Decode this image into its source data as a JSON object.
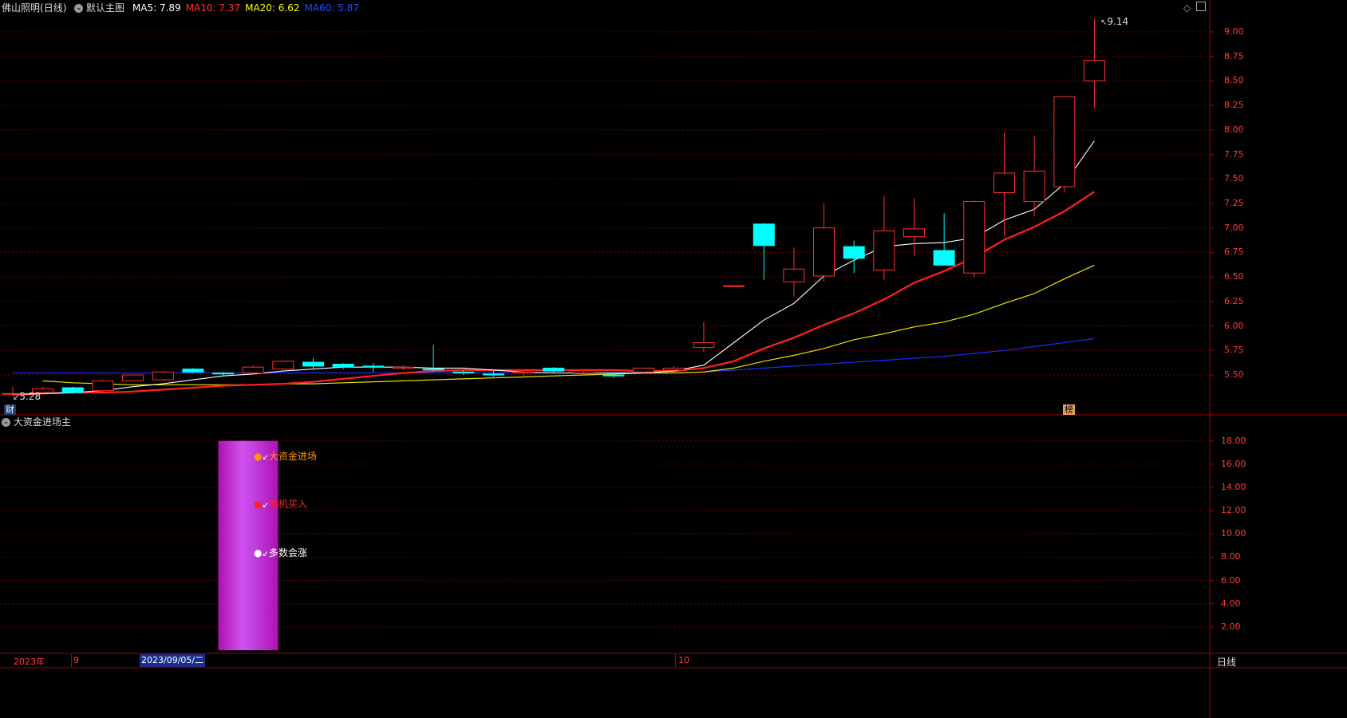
{
  "main_panel": {
    "stock_name": "佛山照明",
    "period_tag": "(日线)",
    "template_label": "默认主图",
    "ma": [
      {
        "label": "MA5:",
        "value": "7.89",
        "color": "#ffffff"
      },
      {
        "label": "MA10:",
        "value": "7.37",
        "color": "#ff3030"
      },
      {
        "label": "MA20:",
        "value": "6.62",
        "color": "#ffff00"
      },
      {
        "label": "MA60:",
        "value": "5.87",
        "color": "#2050ff"
      }
    ],
    "y_ticks": [
      "9.00",
      "8.75",
      "8.50",
      "8.25",
      "8.00",
      "7.75",
      "7.50",
      "7.25",
      "7.00",
      "6.75",
      "6.50",
      "6.25",
      "6.00",
      "5.75",
      "5.50"
    ],
    "high_label": "9.14",
    "low_label": "5.28",
    "badge_left": "财",
    "badge_right": "榜"
  },
  "indicator_panel": {
    "title": "大资金进场主",
    "y_ticks": [
      "18.00",
      "16.00",
      "14.00",
      "12.00",
      "10.00",
      "8.00",
      "6.00",
      "4.00",
      "2.00"
    ],
    "labels": [
      {
        "text": "大资金进场",
        "color": "#ff9900"
      },
      {
        "text": "游机买入",
        "color": "#ff2020"
      },
      {
        "text": "多数会涨",
        "color": "#ffffff"
      }
    ]
  },
  "time_axis": {
    "year": "2023年",
    "month_sep": "9",
    "selected_date": "2023/09/05/二",
    "month_oct": "10",
    "period_button": "日线"
  },
  "colors": {
    "up": "#ff3030",
    "down": "#00ffff",
    "grid": "#6a0000",
    "axis_text": "#ff3b3b",
    "magenta_band": "#c23cdc"
  },
  "chart_data": {
    "type": "candlestick",
    "ylim": [
      5.2,
      9.25
    ],
    "candles": [
      {
        "o": 5.31,
        "h": 5.38,
        "l": 5.28,
        "c": 5.31
      },
      {
        "o": 5.32,
        "h": 5.38,
        "l": 5.3,
        "c": 5.36
      },
      {
        "o": 5.37,
        "h": 5.38,
        "l": 5.31,
        "c": 5.32
      },
      {
        "o": 5.34,
        "h": 5.45,
        "l": 5.33,
        "c": 5.44
      },
      {
        "o": 5.44,
        "h": 5.5,
        "l": 5.43,
        "c": 5.5
      },
      {
        "o": 5.45,
        "h": 5.54,
        "l": 5.44,
        "c": 5.53
      },
      {
        "o": 5.56,
        "h": 5.57,
        "l": 5.52,
        "c": 5.53
      },
      {
        "o": 5.52,
        "h": 5.53,
        "l": 5.49,
        "c": 5.51
      },
      {
        "o": 5.52,
        "h": 5.6,
        "l": 5.51,
        "c": 5.58
      },
      {
        "o": 5.56,
        "h": 5.65,
        "l": 5.55,
        "c": 5.64
      },
      {
        "o": 5.63,
        "h": 5.67,
        "l": 5.57,
        "c": 5.59
      },
      {
        "o": 5.61,
        "h": 5.62,
        "l": 5.56,
        "c": 5.58
      },
      {
        "o": 5.59,
        "h": 5.62,
        "l": 5.53,
        "c": 5.58
      },
      {
        "o": 5.57,
        "h": 5.6,
        "l": 5.55,
        "c": 5.58
      },
      {
        "o": 5.56,
        "h": 5.81,
        "l": 5.53,
        "c": 5.55
      },
      {
        "o": 5.53,
        "h": 5.55,
        "l": 5.5,
        "c": 5.52
      },
      {
        "o": 5.51,
        "h": 5.54,
        "l": 5.48,
        "c": 5.5
      },
      {
        "o": 5.52,
        "h": 5.54,
        "l": 5.47,
        "c": 5.53
      },
      {
        "o": 5.57,
        "h": 5.58,
        "l": 5.52,
        "c": 5.54
      },
      {
        "o": 5.52,
        "h": 5.54,
        "l": 5.5,
        "c": 5.52
      },
      {
        "o": 5.5,
        "h": 5.52,
        "l": 5.47,
        "c": 5.49
      },
      {
        "o": 5.53,
        "h": 5.57,
        "l": 5.51,
        "c": 5.57
      },
      {
        "o": 5.55,
        "h": 5.59,
        "l": 5.52,
        "c": 5.57
      },
      {
        "o": 5.78,
        "h": 6.04,
        "l": 5.73,
        "c": 5.83
      },
      {
        "o": 6.41,
        "h": 6.41,
        "l": 6.41,
        "c": 6.41
      },
      {
        "o": 7.04,
        "h": 7.05,
        "l": 6.47,
        "c": 6.82
      },
      {
        "o": 6.45,
        "h": 6.8,
        "l": 6.3,
        "c": 6.58
      },
      {
        "o": 6.51,
        "h": 7.25,
        "l": 6.45,
        "c": 7.0
      },
      {
        "o": 6.81,
        "h": 6.87,
        "l": 6.54,
        "c": 6.69
      },
      {
        "o": 6.57,
        "h": 7.33,
        "l": 6.47,
        "c": 6.97
      },
      {
        "o": 6.91,
        "h": 7.3,
        "l": 6.71,
        "c": 6.99
      },
      {
        "o": 6.77,
        "h": 7.15,
        "l": 6.62,
        "c": 6.62
      },
      {
        "o": 6.54,
        "h": 7.28,
        "l": 6.5,
        "c": 7.27
      },
      {
        "o": 7.36,
        "h": 7.97,
        "l": 6.92,
        "c": 7.56
      },
      {
        "o": 7.27,
        "h": 7.94,
        "l": 7.12,
        "c": 7.58
      },
      {
        "o": 7.42,
        "h": 8.34,
        "l": 7.36,
        "c": 8.34
      },
      {
        "o": 8.5,
        "h": 9.14,
        "l": 8.22,
        "c": 8.71
      }
    ],
    "ma5": [
      5.3,
      5.31,
      5.32,
      5.34,
      5.38,
      5.41,
      5.45,
      5.49,
      5.51,
      5.54,
      5.56,
      5.58,
      5.58,
      5.58,
      5.57,
      5.57,
      5.55,
      5.53,
      5.52,
      5.52,
      5.52,
      5.52,
      5.54,
      5.6,
      5.83,
      6.06,
      6.23,
      6.51,
      6.67,
      6.81,
      6.84,
      6.85,
      6.9,
      7.08,
      7.19,
      7.45,
      7.89
    ],
    "ma10": [
      5.3,
      5.31,
      5.32,
      5.32,
      5.33,
      5.35,
      5.37,
      5.39,
      5.4,
      5.41,
      5.43,
      5.46,
      5.49,
      5.52,
      5.54,
      5.55,
      5.55,
      5.55,
      5.55,
      5.55,
      5.55,
      5.54,
      5.54,
      5.57,
      5.64,
      5.77,
      5.88,
      6.01,
      6.13,
      6.27,
      6.44,
      6.56,
      6.7,
      6.88,
      7.01,
      7.17,
      7.37
    ],
    "ma20": [
      5.44,
      5.42,
      5.41,
      5.4,
      5.4,
      5.4,
      5.4,
      5.4,
      5.41,
      5.41,
      5.42,
      5.43,
      5.44,
      5.45,
      5.46,
      5.47,
      5.48,
      5.49,
      5.5,
      5.51,
      5.52,
      5.52,
      5.53,
      5.57,
      5.64,
      5.7,
      5.77,
      5.86,
      5.92,
      5.99,
      6.04,
      6.12,
      6.23,
      6.33,
      6.48,
      6.62
    ],
    "ma60": [
      5.52,
      5.52,
      5.52,
      5.52,
      5.52,
      5.52,
      5.52,
      5.52,
      5.52,
      5.52,
      5.52,
      5.52,
      5.52,
      5.52,
      5.52,
      5.52,
      5.52,
      5.52,
      5.52,
      5.52,
      5.52,
      5.52,
      5.52,
      5.53,
      5.55,
      5.57,
      5.59,
      5.61,
      5.63,
      5.65,
      5.67,
      5.69,
      5.72,
      5.75,
      5.79,
      5.83,
      5.87
    ],
    "indicator": {
      "type": "bar",
      "ylim": [
        0,
        19.2
      ],
      "band_value": 18.0,
      "markers": [
        16.0,
        12.0,
        8.0
      ]
    }
  }
}
